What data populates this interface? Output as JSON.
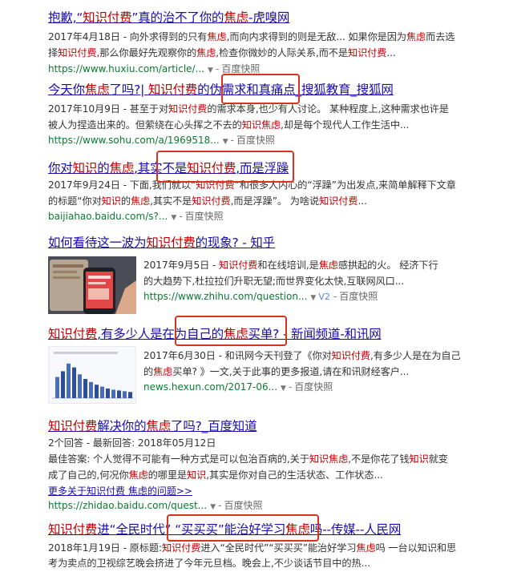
{
  "results": [
    {
      "title_parts": [
        [
          "抱歉,“",
          0
        ],
        [
          "知识付费",
          1
        ],
        [
          "”真的治不了你的",
          0
        ],
        [
          "焦虑",
          1
        ],
        [
          "-虎嗅网",
          0
        ]
      ],
      "desc_lines": [
        [
          [
            "2017年4月18日 - 向外求得到的只有",
            0
          ],
          [
            "焦虑",
            1
          ],
          [
            ",而向内求得到的则是无敌... 如果你是因为",
            0
          ],
          [
            "焦虑",
            1
          ],
          [
            "而去选",
            0
          ]
        ],
        [
          [
            "择",
            0
          ],
          [
            "知识付费",
            1
          ],
          [
            ",那么你最好先观察你的",
            0
          ],
          [
            "焦虑",
            1
          ],
          [
            ",检查你微妙的人际关系,而不是",
            0
          ],
          [
            "知识付费",
            1
          ],
          [
            "...",
            0
          ]
        ]
      ],
      "url": "https://www.huxiu.com/article/...",
      "snapshot": "百度快照"
    },
    {
      "title_parts": [
        [
          "今天你",
          0
        ],
        [
          "焦虑",
          1
        ],
        [
          "了吗?| ",
          0
        ],
        [
          "知识付费",
          1
        ],
        [
          "的伪需求和真痛点_搜狐教育_搜狐网",
          0
        ]
      ],
      "desc_lines": [
        [
          [
            "2017年10月9日 - 甚至于对",
            0
          ],
          [
            "知识付费",
            1
          ],
          [
            "的需求本身,也少有人讨论。 某种程度上,这种需求也许是",
            0
          ]
        ],
        [
          [
            "被人为捏造出来的。但萦绕在心头挥之不去的",
            0
          ],
          [
            "知识",
            1
          ],
          [
            "焦虑",
            1
          ],
          [
            ",却是每个现代人工作生活中...",
            0
          ]
        ]
      ],
      "url": "https://www.sohu.com/a/1969518...",
      "snapshot": "百度快照"
    },
    {
      "title_parts": [
        [
          "你对",
          0
        ],
        [
          "知识",
          1
        ],
        [
          "的",
          0
        ],
        [
          "焦虑",
          1
        ],
        [
          ",其实不是",
          0
        ],
        [
          "知识付费",
          1
        ],
        [
          ",而是浮躁",
          0
        ]
      ],
      "desc_lines": [
        [
          [
            "2017年9月24日 - 下面,我们就以“",
            0
          ],
          [
            "知识付费",
            1
          ],
          [
            "”和很多人内心的“浮躁”为出发点,来简单解释下文章",
            0
          ]
        ],
        [
          [
            "的标题“你对",
            0
          ],
          [
            "知识",
            1
          ],
          [
            "的",
            0
          ],
          [
            "焦虑",
            1
          ],
          [
            ",其实不是",
            0
          ],
          [
            "知识付费",
            1
          ],
          [
            ",而是浮躁”。 为啥说",
            0
          ],
          [
            "知识付费",
            1
          ],
          [
            "...",
            0
          ]
        ]
      ],
      "url": "baijiahao.baidu.com/s?...",
      "snapshot": "百度快照"
    },
    {
      "title_parts": [
        [
          "如何看待这一波为",
          0
        ],
        [
          "知识付费",
          1
        ],
        [
          "的现象? - 知乎",
          0
        ]
      ],
      "desc_lines": [
        [
          [
            "2017年9月5日 - ",
            0
          ],
          [
            "知识付费",
            1
          ],
          [
            "和在线培训,是",
            0
          ],
          [
            "焦虑",
            1
          ],
          [
            "感拱起的火。 经济下行",
            0
          ]
        ],
        [
          [
            "的大趋势下,杜拉拉们升职无望;而世界变化太快,互联网风口...",
            0
          ]
        ]
      ],
      "url": "https://www.zhihu.com/question...",
      "badge": "V2",
      "snapshot": "百度快照"
    },
    {
      "title_parts": [
        [
          "知识付费",
          1
        ],
        [
          ",有多少人是在为自己的",
          0
        ],
        [
          "焦虑",
          1
        ],
        [
          "买单? - 新闻频道-和讯网",
          0
        ]
      ],
      "desc_lines": [
        [
          [
            "2017年6月30日 - 和讯网今天刊登了《你对",
            0
          ],
          [
            "知识付费",
            1
          ],
          [
            ",有多少人是在为自己",
            0
          ]
        ],
        [
          [
            "的",
            0
          ],
          [
            "焦虑",
            1
          ],
          [
            "买单? 》一文,关于此事的更多报道,请在和讯财经客户...",
            0
          ]
        ]
      ],
      "url": "news.hexun.com/2017-06...",
      "snapshot": "百度快照"
    },
    {
      "title_parts": [
        [
          "知识付费",
          1
        ],
        [
          "解决你的",
          0
        ],
        [
          "焦虑",
          1
        ],
        [
          "了吗?_百度知道",
          0
        ]
      ],
      "desc_lines": [
        [
          [
            "2个回答 - 最新回答: 2018年05月12日",
            0
          ]
        ],
        [
          [
            "最佳答案: 个人觉得不可能有一种方式是可以包治百病的,关于",
            0
          ],
          [
            "知识焦虑",
            1
          ],
          [
            ",不是你花了钱",
            0
          ],
          [
            "知识",
            1
          ],
          [
            "就变",
            0
          ]
        ],
        [
          [
            "成了自己的,何况你",
            0
          ],
          [
            "焦虑",
            1
          ],
          [
            "的哪里是",
            0
          ],
          [
            "知识",
            1
          ],
          [
            ",其实是你对自己的生活状态、工作状态...",
            0
          ]
        ]
      ],
      "more_link": "更多关于知识付费 焦虑的问题>>",
      "url": "https://zhidao.baidu.com/quest...",
      "snapshot": "百度快照"
    },
    {
      "title_parts": [
        [
          "知识付费",
          1
        ],
        [
          "进“全民时代” “买买买”能治好学习",
          0
        ],
        [
          "焦虑",
          1
        ],
        [
          "吗--传媒--人民网",
          0
        ]
      ],
      "desc_lines": [
        [
          [
            "2018年1月19日 - 原标题:",
            0
          ],
          [
            "知识付费",
            1
          ],
          [
            "进入“全民时代”“买买买”能治好学习",
            0
          ],
          [
            "焦虑",
            1
          ],
          [
            "吗 一台以知识和思",
            0
          ]
        ],
        [
          [
            "考为卖点的卫视综艺晚会挤进了今年元旦档。晚会上,不少谈话节目中的热...",
            0
          ]
        ]
      ]
    }
  ],
  "thumb_chart_heights": [
    0.55,
    0.7,
    0.9,
    0.8,
    0.62,
    0.5,
    0.42,
    0.35,
    0.3,
    0.25,
    0.22,
    0.2,
    0.18,
    0.16
  ],
  "colors": {
    "title": "#1a0dab",
    "highlight": "#c00000",
    "url": "#0a7a2f",
    "box": "#d9331e"
  }
}
